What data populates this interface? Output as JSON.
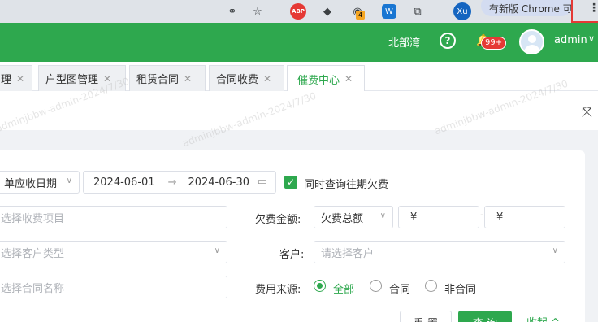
{
  "browser": {
    "ext_abp": "ABP",
    "ext_badge": "4",
    "ext_blue": "W",
    "profile": "Xu",
    "update_label": "有新版 Chrome 可用"
  },
  "header": {
    "org": "北部湾",
    "notif_count": "99+",
    "username": "admin"
  },
  "tabs": [
    {
      "label": "理"
    },
    {
      "label": "户型图管理"
    },
    {
      "label": "租赁合同"
    },
    {
      "label": "合同收费"
    },
    {
      "label": "催费中心",
      "active": true
    }
  ],
  "watermark": "adminjbbw-admin-2024/7/30",
  "filters": {
    "date_type": "单应收日期",
    "date_start": "2024-06-01",
    "date_arrow": "→",
    "date_end": "2024-06-30",
    "history_label": "同时查询往期欠费",
    "fee_item_placeholder": "选择收费项目",
    "customer_type_placeholder": "选择客户类型",
    "contract_placeholder": "选择合同名称",
    "arrears_label": "欠费金额:",
    "arrears_type": "欠费总额",
    "currency_min": "¥",
    "dash": "-",
    "currency_max": "¥",
    "customer_label": "客户:",
    "customer_placeholder": "请选择客户",
    "source_label": "费用来源:",
    "source_options": [
      "全部",
      "合同",
      "非合同"
    ]
  },
  "actions": {
    "reset": "重 置",
    "query": "查 询",
    "collapse": "收起 ^"
  },
  "colors": {
    "brand": "#2ea84e",
    "notif": "#e53935"
  }
}
